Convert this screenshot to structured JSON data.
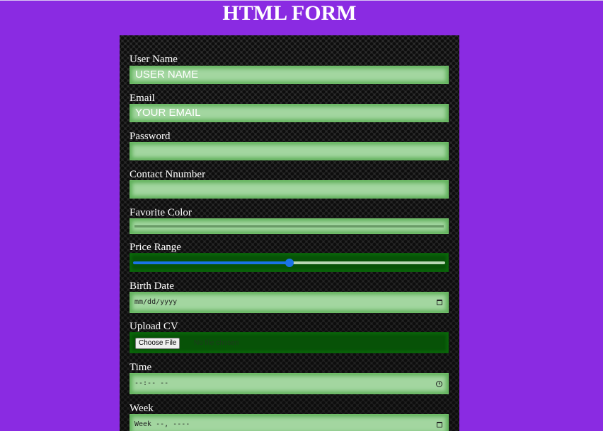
{
  "page": {
    "title": "HTML FORM"
  },
  "form": {
    "user_name": {
      "label": "User Name",
      "placeholder": "USER NAME"
    },
    "email": {
      "label": "Email",
      "placeholder": "YOUR EMAIL"
    },
    "password": {
      "label": "Password",
      "value": ""
    },
    "contact_number": {
      "label": "Contact Nnumber",
      "value": ""
    },
    "favorite_color": {
      "label": "Favorite Color",
      "value_color": "#6a9c67"
    },
    "price_range": {
      "label": "Price Range",
      "value_fraction": 0.5
    },
    "birth_date": {
      "label": "Birth Date",
      "placeholder": "mm/dd/yyyy",
      "icon": "calendar-icon"
    },
    "upload_cv": {
      "label": "Upload CV",
      "button_label": "Choose File",
      "status": "No file chosen"
    },
    "time": {
      "label": "Time",
      "placeholder": "--:-- --",
      "icon": "clock-icon"
    },
    "week": {
      "label": "Week",
      "placeholder": "Week --, ----",
      "icon": "calendar-icon"
    }
  },
  "colors": {
    "page_background": "#8a2be2",
    "input_fill": "#a3d6a0",
    "input_glow": "#5fb05a",
    "dark_input_fill": "#075207",
    "slider_accent": "#1a73e8"
  }
}
